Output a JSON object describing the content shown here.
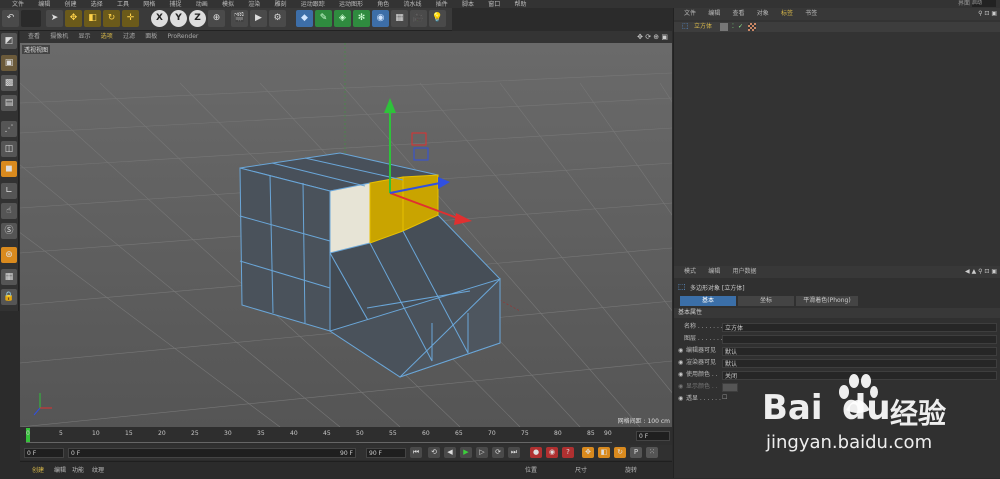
{
  "menubar": {
    "items": [
      "文件",
      "编辑",
      "创建",
      "选择",
      "工具",
      "网格",
      "捕捉",
      "动画",
      "模拟",
      "渲染",
      "雕刻",
      "运动跟踪",
      "运动图形",
      "角色",
      "流水线",
      "插件",
      "脚本",
      "窗口",
      "帮助"
    ],
    "right_label": "界面",
    "right_value": "启动"
  },
  "viewport": {
    "menu": [
      "查看",
      "摄像机",
      "显示",
      "选项",
      "过滤",
      "面板",
      "ProRender"
    ],
    "active_menu": "选项",
    "label": "透视视图",
    "grid_info": "网格间距 : 100 cm"
  },
  "timeline": {
    "ticks": [
      "0",
      "5",
      "10",
      "15",
      "20",
      "25",
      "30",
      "35",
      "40",
      "45",
      "50",
      "55",
      "60",
      "65",
      "70",
      "75",
      "80",
      "85",
      "90"
    ],
    "current": "0 F"
  },
  "transport": {
    "start": "0 F",
    "slider_start": "0 F",
    "slider_end": "90 F",
    "end": "90 F"
  },
  "bottombar": {
    "tabs": [
      "创建",
      "编辑",
      "功能",
      "纹理"
    ],
    "coord_headers": [
      "位置",
      "尺寸",
      "旋转"
    ]
  },
  "objects": {
    "menu": [
      "文件",
      "编辑",
      "查看",
      "对象",
      "标签",
      "书签"
    ],
    "active_menu": "标签",
    "items": [
      {
        "name": "立方体"
      }
    ]
  },
  "attributes": {
    "menu": [
      "模式",
      "编辑",
      "用户数据"
    ],
    "title": "多边形对象 [立方体]",
    "tabs": [
      "基本",
      "坐标",
      "平滑着色(Phong)"
    ],
    "active_tab": "基本",
    "section": "基本属性",
    "rows": [
      {
        "label": "名称 . . . . . . .",
        "value": "立方体"
      },
      {
        "label": "图层 . . . . . . .",
        "value": ""
      },
      {
        "label": "编辑器可见",
        "value": "默认"
      },
      {
        "label": "渲染器可见",
        "value": "默认"
      },
      {
        "label": "使用颜色 . .",
        "value": "关闭"
      },
      {
        "label": "显示颜色 . .",
        "value": ""
      },
      {
        "label": "透显 . . . . . .",
        "value": ""
      }
    ]
  },
  "watermark": {
    "brand": "Bai",
    "brand2": "du",
    "sub": "经验",
    "url": "jingyan.baidu.com"
  },
  "colors": {
    "selection": "#c9a400",
    "grid": "#5c5c5c",
    "accent_blue": "#3b6fa8"
  }
}
